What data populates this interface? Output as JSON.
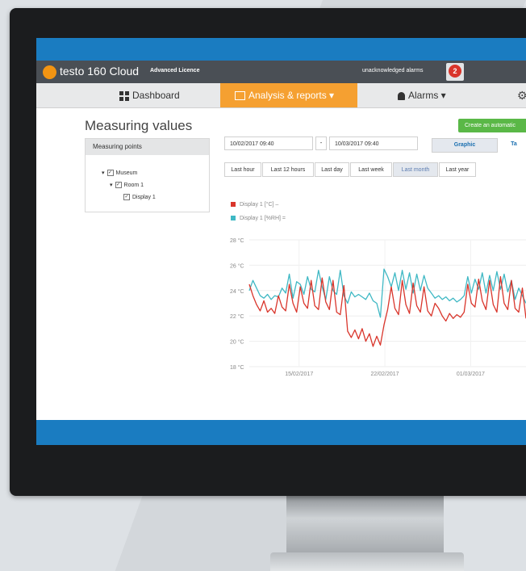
{
  "app": {
    "title": "testo 160 Cloud",
    "licence": "Advanced Licence",
    "alarm_text": "unacknowledged alarms",
    "alarm_count": "2"
  },
  "nav": {
    "dashboard": "Dashboard",
    "analysis": "Analysis & reports",
    "alarms": "Alarms"
  },
  "page": {
    "title": "Measuring values",
    "automatic_button": "Create an automatic"
  },
  "panel": {
    "title": "Measuring points",
    "tree": [
      "Museum",
      "Room 1",
      "Display 1"
    ]
  },
  "dates": {
    "from": "10/02/2017 09:40",
    "separator": "-",
    "to": "10/03/2017 09:40"
  },
  "views": {
    "graphic": "Graphic",
    "table": "Ta"
  },
  "ranges": [
    "Last hour",
    "Last 12 hours",
    "Last day",
    "Last week",
    "Last month",
    "Last year"
  ],
  "selected_range": "Last month",
  "chart_data": {
    "type": "line",
    "series": [
      {
        "name": "Display 1 [°C] –",
        "color": "#d9352b",
        "y": [
          24.5,
          23.6,
          22.9,
          22.4,
          23.2,
          22.3,
          22.6,
          22.2,
          23.6,
          22.7,
          22.4,
          24.5,
          23.0,
          22.3,
          24.3,
          23.0,
          22.6,
          24.8,
          22.8,
          22.5,
          25.0,
          23.1,
          22.5,
          24.8,
          22.3,
          22.1,
          24.4,
          20.8,
          20.3,
          20.9,
          20.2,
          21.0,
          20.0,
          20.6,
          19.6,
          20.4,
          19.7,
          21.3,
          22.5,
          24.3,
          22.6,
          22.1,
          24.8,
          22.9,
          22.2,
          24.6,
          22.8,
          22.3,
          24.3,
          22.4,
          22.0,
          23.0,
          22.6,
          22.0,
          21.6,
          22.2,
          21.8,
          22.1,
          21.9,
          22.3,
          24.5,
          23.0,
          22.7,
          24.9,
          23.2,
          22.5,
          24.8,
          22.9,
          22.3,
          25.1,
          23.0,
          22.5,
          24.8,
          22.6,
          22.3,
          24.2,
          21.8
        ]
      },
      {
        "name": "Display 1 [%RH] =",
        "color": "#3fb8c4",
        "y": [
          24.0,
          24.8,
          24.2,
          23.6,
          23.4,
          23.7,
          23.3,
          23.6,
          23.5,
          24.2,
          23.8,
          25.3,
          23.4,
          24.7,
          24.5,
          23.7,
          25.1,
          24.1,
          23.9,
          25.6,
          24.3,
          23.3,
          25.1,
          24.0,
          23.7,
          25.6,
          23.6,
          23.0,
          23.9,
          23.5,
          23.7,
          23.5,
          23.3,
          23.8,
          23.2,
          23.0,
          21.9,
          25.7,
          25.1,
          24.3,
          25.4,
          24.0,
          25.6,
          24.1,
          25.4,
          23.8,
          25.3,
          24.0,
          25.2,
          24.2,
          23.8,
          23.4,
          23.6,
          23.3,
          23.5,
          23.2,
          23.4,
          23.1,
          23.3,
          23.6,
          25.1,
          23.8,
          24.9,
          24.1,
          25.4,
          23.8,
          25.2,
          24.0,
          25.5,
          24.1,
          25.3,
          23.9,
          24.8,
          23.3,
          24.2,
          23.6,
          23.0
        ]
      }
    ],
    "y_ticks": [
      "28 °C",
      "26 °C",
      "24 °C",
      "22 °C",
      "20 °C",
      "18 °C"
    ],
    "ylim": [
      18,
      28
    ],
    "x_ticks": [
      "15/02/2017",
      "22/02/2017",
      "01/03/2017"
    ],
    "grid": true
  },
  "colors": {
    "topbar": "#1a7cc1",
    "active_tab": "#f5a031",
    "green_button": "#5ab847"
  }
}
